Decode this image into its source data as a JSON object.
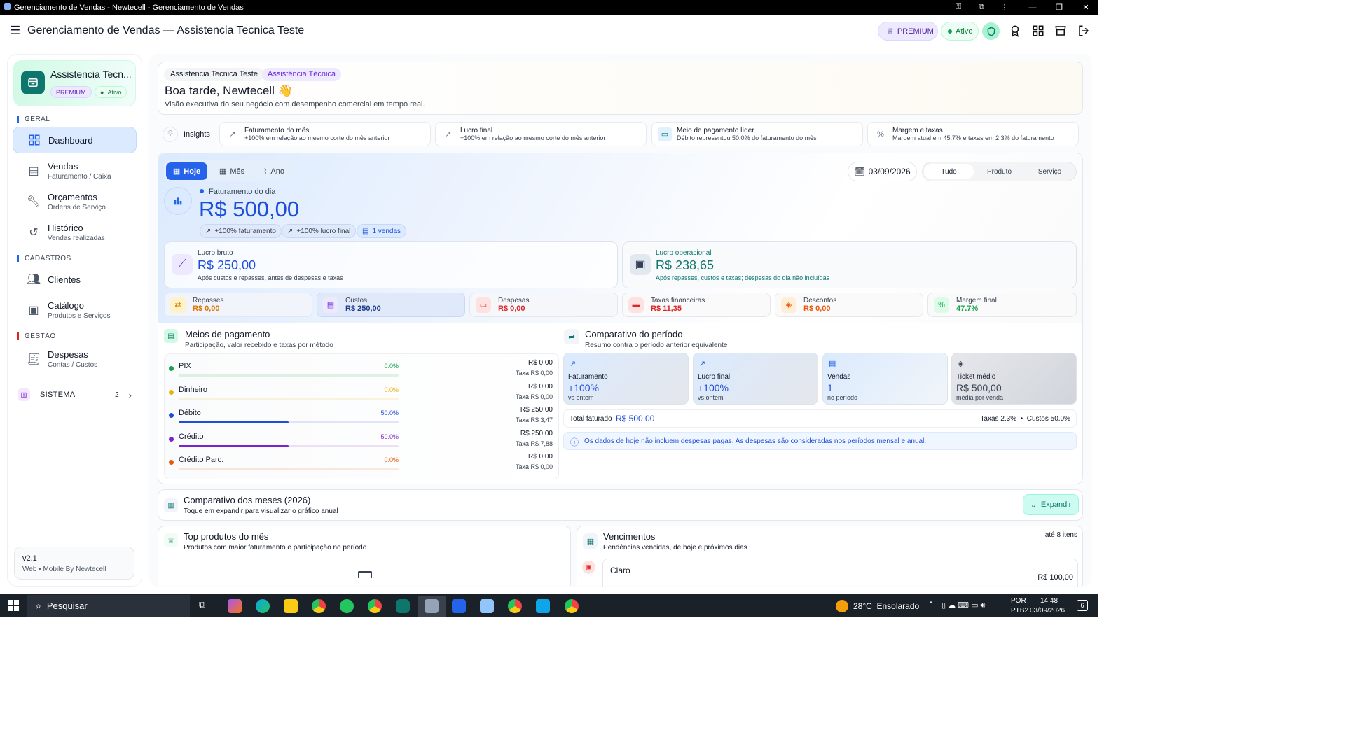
{
  "window": {
    "title": "Gerenciamento de Vendas - Newtecell - Gerenciamento de Vendas"
  },
  "appbar": {
    "title": "Gerenciamento de Vendas — Assistencia Tecnica Teste",
    "premium": "PREMIUM",
    "status": "Ativo"
  },
  "sidebar": {
    "store_name": "Assistencia Tecn...",
    "premium": "PREMIUM",
    "status": "Ativo",
    "sections": {
      "geral": "GERAL",
      "cadastros": "CADASTROS",
      "gestao": "GESTÃO"
    },
    "items": [
      {
        "label": "Dashboard",
        "sub": ""
      },
      {
        "label": "Vendas",
        "sub": "Faturamento / Caixa"
      },
      {
        "label": "Orçamentos",
        "sub": "Ordens de Serviço"
      },
      {
        "label": "Histórico",
        "sub": "Vendas realizadas"
      },
      {
        "label": "Clientes",
        "sub": ""
      },
      {
        "label": "Catálogo",
        "sub": "Produtos e Serviços"
      },
      {
        "label": "Despesas",
        "sub": "Contas / Custos"
      }
    ],
    "sistema": {
      "label": "SISTEMA",
      "count": "2"
    },
    "footer": {
      "version": "v2.1",
      "credit": "Web • Mobile By Newtecell"
    }
  },
  "header": {
    "tag1": "Assistencia Tecnica Teste",
    "tag2": "Assistência Técnica",
    "greeting": "Boa tarde, Newtecell 👋",
    "subtitle": "Visão executiva do seu negócio com desempenho comercial em tempo real."
  },
  "insights": {
    "label": "Insights",
    "items": [
      {
        "title": "Faturamento do mês",
        "sub": "+100% em relação ao mesmo corte do mês anterior"
      },
      {
        "title": "Lucro final",
        "sub": "+100% em relação ao mesmo corte do mês anterior"
      },
      {
        "title": "Meio de pagamento líder",
        "sub": "Débito representou 50.0% do faturamento do mês"
      },
      {
        "title": "Margem e taxas",
        "sub": "Margem atual em 45.7% e taxas em 2.3% do faturamento"
      }
    ]
  },
  "period": {
    "tabs": [
      "Hoje",
      "Mês",
      "Ano"
    ],
    "date": "03/09/2026",
    "filters": [
      "Tudo",
      "Produto",
      "Serviço"
    ]
  },
  "hero": {
    "label": "Faturamento do dia",
    "value": "R$ 500,00",
    "badges": [
      "+100% faturamento",
      "+100% lucro final",
      "1 vendas"
    ]
  },
  "profit": {
    "bruto": {
      "label": "Lucro bruto",
      "value": "R$ 250,00",
      "sub": "Após custos e repasses, antes de despesas e taxas"
    },
    "operacional": {
      "label": "Lucro operacional",
      "value": "R$ 238,65",
      "sub": "Após repasses, custos e taxas; despesas do dia não incluídas"
    }
  },
  "metrics": [
    {
      "label": "Repasses",
      "value": "R$ 0,00"
    },
    {
      "label": "Custos",
      "value": "R$ 250,00"
    },
    {
      "label": "Despesas",
      "value": "R$ 0,00"
    },
    {
      "label": "Taxas financeiras",
      "value": "R$ 11,35"
    },
    {
      "label": "Descontos",
      "value": "R$ 0,00"
    },
    {
      "label": "Margem final",
      "value": "47.7%"
    }
  ],
  "payments": {
    "title": "Meios de pagamento",
    "sub": "Participação, valor recebido e taxas por método",
    "items": [
      {
        "name": "PIX",
        "pct": "0.0%",
        "share": 0.0,
        "amount": "R$ 0,00",
        "tax": "Taxa R$ 0,00",
        "color": "#16a34a"
      },
      {
        "name": "Dinheiro",
        "pct": "0.0%",
        "share": 0.0,
        "amount": "R$ 0,00",
        "tax": "Taxa R$ 0,00",
        "color": "#eab308"
      },
      {
        "name": "Débito",
        "pct": "50.0%",
        "share": 0.5,
        "amount": "R$ 250,00",
        "tax": "Taxa R$ 3,47",
        "color": "#1d4ed8"
      },
      {
        "name": "Crédito",
        "pct": "50.0%",
        "share": 0.5,
        "amount": "R$ 250,00",
        "tax": "Taxa R$ 7,88",
        "color": "#7e22ce"
      },
      {
        "name": "Crédito Parc.",
        "pct": "0.0%",
        "share": 0.0,
        "amount": "R$ 0,00",
        "tax": "Taxa R$ 0,00",
        "color": "#ea580c"
      }
    ]
  },
  "comparison": {
    "title": "Comparativo do período",
    "sub": "Resumo contra o período anterior equivalente",
    "cards": [
      {
        "label": "Faturamento",
        "value": "+100%",
        "sub": "vs ontem"
      },
      {
        "label": "Lucro final",
        "value": "+100%",
        "sub": "vs ontem"
      },
      {
        "label": "Vendas",
        "value": "1",
        "sub": "no período"
      },
      {
        "label": "Ticket médio",
        "value": "R$ 500,00",
        "sub": "média por venda"
      }
    ],
    "total_label": "Total faturado",
    "total_value": "R$ 500,00",
    "rates": "Taxas 2.3%  •  Custos 50.0%",
    "info": "Os dados de hoje não incluem despesas pagas. As despesas são consideradas nos períodos mensal e anual."
  },
  "months": {
    "title": "Comparativo dos meses (2026)",
    "sub": "Toque em expandir para visualizar o gráfico anual",
    "button": "Expandir"
  },
  "top_products": {
    "title": "Top produtos do mês",
    "sub": "Produtos com maior faturamento e participação no período"
  },
  "due": {
    "title": "Vencimentos",
    "sub": "Pendências vencidas, de hoje e próximos dias",
    "limit": "até 8 itens",
    "first_name": "Claro",
    "first_value": "R$ 100,00"
  },
  "taskbar": {
    "search": "Pesquisar",
    "weather": "28°C  Ensolarado",
    "lang1": "POR",
    "lang2": "PTB2",
    "time": "14:48",
    "date": "03/09/2026",
    "notif": "6"
  }
}
